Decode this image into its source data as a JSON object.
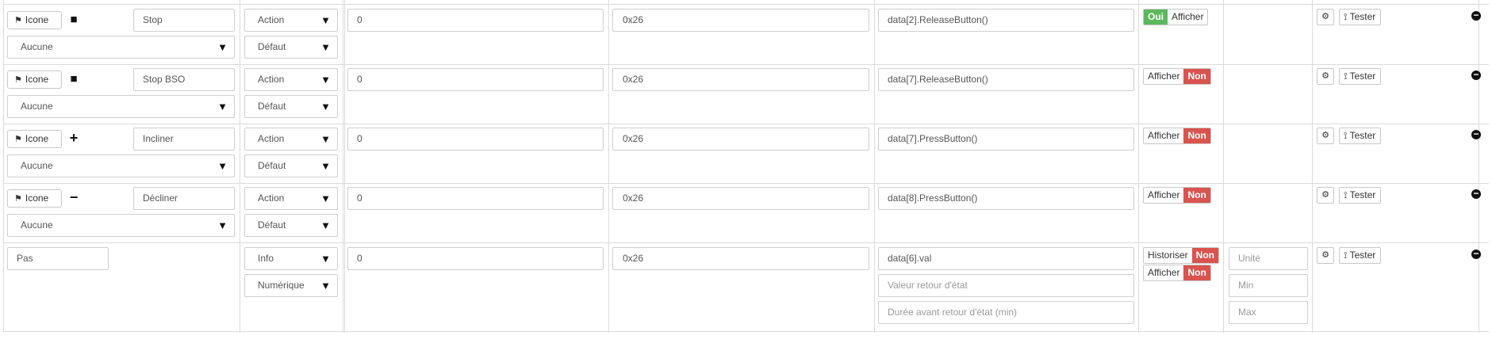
{
  "rows": [
    {
      "icon_button": "Icone",
      "type_icon": "stop-square-icon",
      "type_icon_glyph": "■",
      "name": "Stop",
      "object": "Aucune",
      "type": "Action",
      "subtype": "Défaut",
      "value": "0",
      "address": "0x26",
      "command": "data[2].ReleaseButton()",
      "toggles": [
        {
          "on": "Oui",
          "off": "Afficher",
          "state": "on"
        }
      ],
      "test_label": "Tester"
    },
    {
      "icon_button": "Icone",
      "type_icon": "stop-square-icon",
      "type_icon_glyph": "■",
      "name": "Stop BSO",
      "object": "Aucune",
      "type": "Action",
      "subtype": "Défaut",
      "value": "0",
      "address": "0x26",
      "command": "data[7].ReleaseButton()",
      "toggles": [
        {
          "off": "Afficher",
          "no": "Non",
          "state": "off"
        }
      ],
      "test_label": "Tester"
    },
    {
      "icon_button": "Icone",
      "type_icon": "plus-icon",
      "type_icon_glyph": "+",
      "name": "Incliner",
      "object": "Aucune",
      "type": "Action",
      "subtype": "Défaut",
      "value": "0",
      "address": "0x26",
      "command": "data[7].PressButton()",
      "toggles": [
        {
          "off": "Afficher",
          "no": "Non",
          "state": "off"
        }
      ],
      "test_label": "Tester"
    },
    {
      "icon_button": "Icone",
      "type_icon": "minus-icon",
      "type_icon_glyph": "−",
      "name": "Décliner",
      "object": "Aucune",
      "type": "Action",
      "subtype": "Défaut",
      "value": "0",
      "address": "0x26",
      "command": "data[8].PressButton()",
      "toggles": [
        {
          "off": "Afficher",
          "no": "Non",
          "state": "off"
        }
      ],
      "test_label": "Tester"
    }
  ],
  "info_row": {
    "name": "Pas",
    "type": "Info",
    "subtype": "Numérique",
    "value": "0",
    "address": "0x26",
    "command": "data[6].val",
    "return_state_placeholder": "Valeur retour d'état",
    "return_delay_placeholder": "Durée avant retour d'état (min)",
    "historize_label": "Historiser",
    "historize_value": "Non",
    "display_label": "Afficher",
    "display_value": "Non",
    "unit_placeholder": "Unité",
    "min_placeholder": "Min",
    "max_placeholder": "Max",
    "test_label": "Tester"
  },
  "icons": {
    "flag": "flag-icon",
    "advanced": "gears-icon",
    "test": "rss-icon",
    "remove": "minus-circle-icon"
  },
  "colors": {
    "green": "#5cb85c",
    "red": "#d9534f"
  }
}
